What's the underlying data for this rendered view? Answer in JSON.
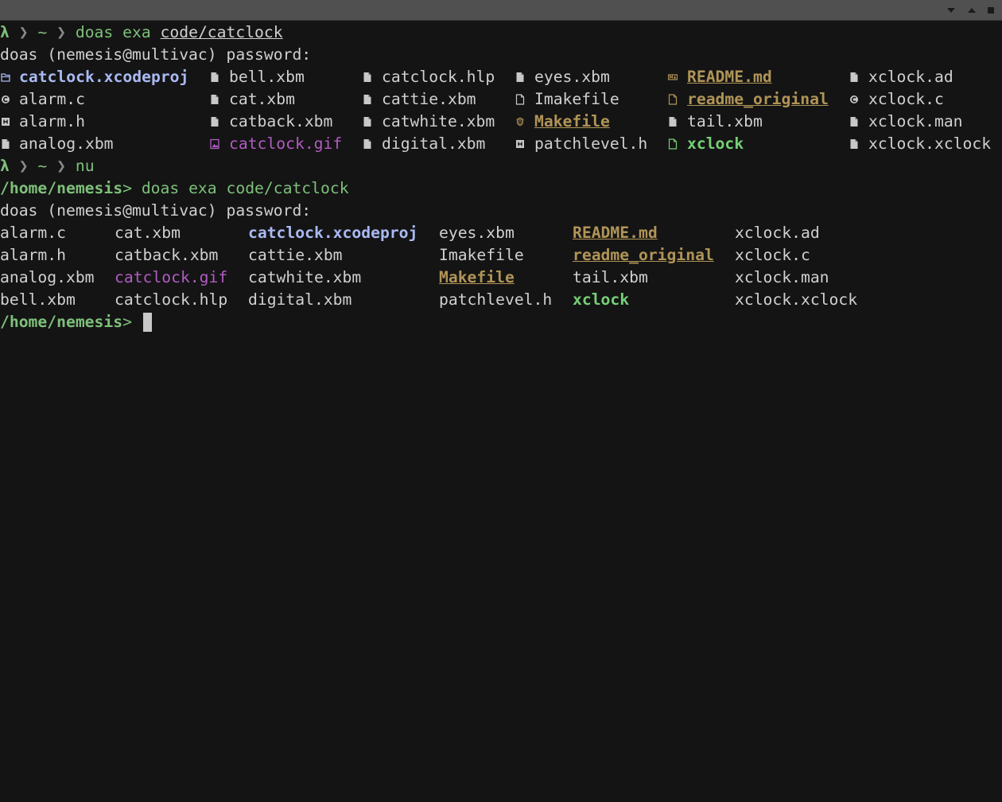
{
  "window": {
    "buttons": [
      "minimize",
      "maximize",
      "close"
    ]
  },
  "colors": {
    "background": "#141414",
    "prompt_green": "#7ec07a",
    "directory_blue": "#a9b9f2",
    "image_magenta": "#b15cc2",
    "doc_gold": "#b09457",
    "executable_green": "#76cf76"
  },
  "session": {
    "zsh_prompt": {
      "lambda": "λ",
      "sep1": " ❯ ",
      "cwd": "~",
      "sep2": " ❯ "
    },
    "cmd1": {
      "text": "doas exa ",
      "path": "code/catclock"
    },
    "password_prompt": "doas (nemesis@multivac) password:",
    "exa_grid": [
      [
        {
          "name": "catclock.xcodeproj",
          "icon": "folder-icon",
          "kind": "dir"
        },
        {
          "name": "bell.xbm",
          "icon": "file-icon",
          "kind": "plain"
        },
        {
          "name": "catclock.hlp",
          "icon": "file-icon",
          "kind": "plain"
        },
        {
          "name": "eyes.xbm",
          "icon": "file-icon",
          "kind": "plain"
        },
        {
          "name": "README.md",
          "icon": "markdown-icon",
          "kind": "doc"
        },
        {
          "name": "xclock.ad",
          "icon": "file-icon",
          "kind": "plain"
        }
      ],
      [
        {
          "name": "alarm.c",
          "icon": "c-source-icon",
          "kind": "plain"
        },
        {
          "name": "cat.xbm",
          "icon": "file-icon",
          "kind": "plain"
        },
        {
          "name": "cattie.xbm",
          "icon": "file-icon",
          "kind": "plain"
        },
        {
          "name": "Imakefile",
          "icon": "file-outline-icon",
          "kind": "plain"
        },
        {
          "name": "readme_original",
          "icon": "file-outline-icon",
          "kind": "doc"
        },
        {
          "name": "xclock.c",
          "icon": "c-source-icon",
          "kind": "plain"
        }
      ],
      [
        {
          "name": "alarm.h",
          "icon": "header-file-icon",
          "kind": "plain"
        },
        {
          "name": "catback.xbm",
          "icon": "file-icon",
          "kind": "plain"
        },
        {
          "name": "catwhite.xbm",
          "icon": "file-icon",
          "kind": "plain"
        },
        {
          "name": "Makefile",
          "icon": "makefile-icon",
          "kind": "doc"
        },
        {
          "name": "tail.xbm",
          "icon": "file-icon",
          "kind": "plain"
        },
        {
          "name": "xclock.man",
          "icon": "file-icon",
          "kind": "plain"
        }
      ],
      [
        {
          "name": "analog.xbm",
          "icon": "file-icon",
          "kind": "plain"
        },
        {
          "name": "catclock.gif",
          "icon": "image-file-icon",
          "kind": "img"
        },
        {
          "name": "digital.xbm",
          "icon": "file-icon",
          "kind": "plain"
        },
        {
          "name": "patchlevel.h",
          "icon": "header-file-icon",
          "kind": "plain"
        },
        {
          "name": "xclock",
          "icon": "file-outline-icon",
          "kind": "exec"
        },
        {
          "name": "xclock.xclock",
          "icon": "file-icon",
          "kind": "plain"
        }
      ]
    ],
    "cmd2": "nu",
    "nu_prompt": "/home/nemesis",
    "nu_caret": "> ",
    "cmd3": "doas exa code/catclock",
    "nu_grid": [
      [
        {
          "name": "alarm.c",
          "kind": "plain"
        },
        {
          "name": "cat.xbm",
          "kind": "plain"
        },
        {
          "name": "catclock.xcodeproj",
          "kind": "dir"
        },
        {
          "name": "eyes.xbm",
          "kind": "plain"
        },
        {
          "name": "README.md",
          "kind": "doc"
        },
        {
          "name": "xclock.ad",
          "kind": "plain"
        }
      ],
      [
        {
          "name": "alarm.h",
          "kind": "plain"
        },
        {
          "name": "catback.xbm",
          "kind": "plain"
        },
        {
          "name": "cattie.xbm",
          "kind": "plain"
        },
        {
          "name": "Imakefile",
          "kind": "plain"
        },
        {
          "name": "readme_original",
          "kind": "doc"
        },
        {
          "name": "xclock.c",
          "kind": "plain"
        }
      ],
      [
        {
          "name": "analog.xbm",
          "kind": "plain"
        },
        {
          "name": "catclock.gif",
          "kind": "img"
        },
        {
          "name": "catwhite.xbm",
          "kind": "plain"
        },
        {
          "name": "Makefile",
          "kind": "doc"
        },
        {
          "name": "tail.xbm",
          "kind": "plain"
        },
        {
          "name": "xclock.man",
          "kind": "plain"
        }
      ],
      [
        {
          "name": "bell.xbm",
          "kind": "plain"
        },
        {
          "name": "catclock.hlp",
          "kind": "plain"
        },
        {
          "name": "digital.xbm",
          "kind": "plain"
        },
        {
          "name": "patchlevel.h",
          "kind": "plain"
        },
        {
          "name": "xclock",
          "kind": "exec"
        },
        {
          "name": "xclock.xclock",
          "kind": "plain"
        }
      ]
    ]
  }
}
